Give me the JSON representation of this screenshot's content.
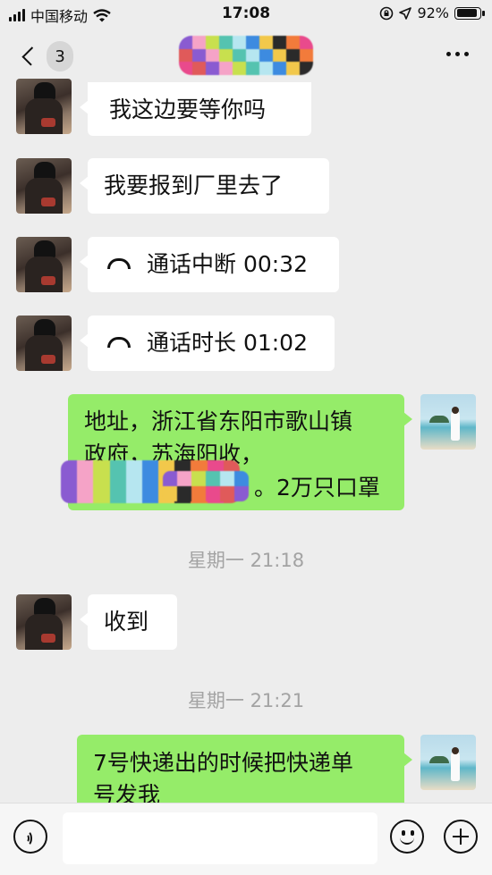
{
  "status_bar": {
    "carrier": "中国移动",
    "time": "17:08",
    "battery_percent": "92%",
    "battery_level": 0.92,
    "icons": [
      "signal-icon",
      "wifi-icon",
      "lock-rotation-icon",
      "location-arrow-icon",
      "battery-icon"
    ]
  },
  "nav": {
    "unread_count": "3",
    "back_icon": "chevron-left-icon",
    "more_icon": "more-dots-icon"
  },
  "messages": [
    {
      "side": "left",
      "text": "我这边要等你吗"
    },
    {
      "side": "left",
      "text": "我要报到厂里去了"
    },
    {
      "side": "left",
      "type": "call",
      "icon": "phone-hangup-icon",
      "text": "通话中断 00:32"
    },
    {
      "side": "left",
      "type": "call",
      "icon": "phone-hangup-icon",
      "text": "通话时长 01:02"
    },
    {
      "side": "right",
      "lines": [
        "地址，浙江省东阳市歌山镇",
        "政府，苏海阳收，",
        "。2万只口罩"
      ]
    },
    {
      "side": "left",
      "text": "收到"
    },
    {
      "side": "right",
      "lines": [
        "7号快递出的时候把快递单",
        "号发我"
      ]
    }
  ],
  "timestamps": [
    "星期一 21:18",
    "星期一 21:21"
  ],
  "input_bar": {
    "voice_icon": "voice-icon",
    "emoji_icon": "emoji-icon",
    "plus_icon": "plus-icon"
  },
  "colors": {
    "background": "#ededed",
    "sent_bubble": "#95ec69",
    "received_bubble": "#ffffff",
    "timestamp_text": "#a3a3a3"
  }
}
